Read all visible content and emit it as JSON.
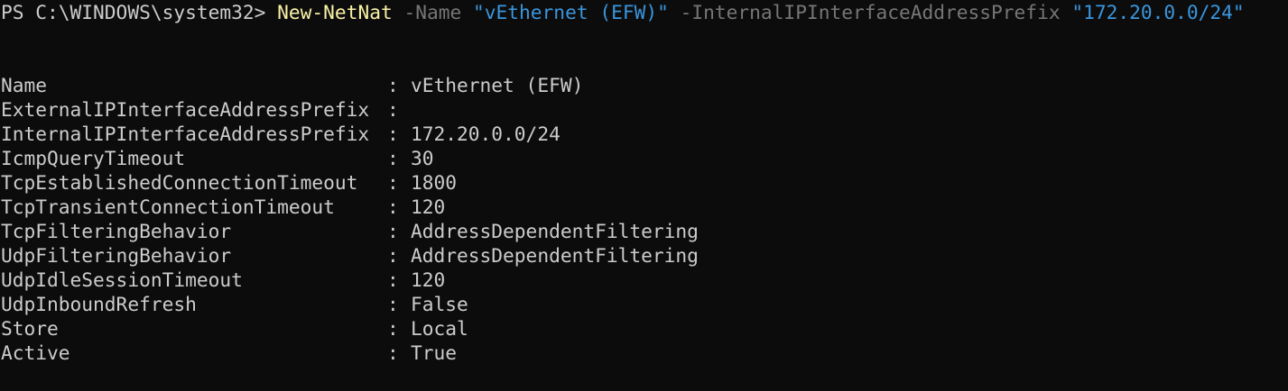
{
  "colors": {
    "background": "#0c0c0c",
    "foreground": "#cccccc",
    "cmdlet": "#f9f1a5",
    "parameter": "#767676",
    "string": "#3a96dd"
  },
  "command": {
    "prompt": "PS C:\\WINDOWS\\system32> ",
    "cmdlet": "New-NetNat",
    "param1": " -Name ",
    "value1": "\"vEthernet (EFW)\"",
    "param2": " -InternalIPInterfaceAddressPrefix ",
    "value2": "\"172.20.0.0/24\""
  },
  "output": {
    "separator": ":",
    "rows": [
      {
        "key": "Name",
        "value": "vEthernet (EFW)"
      },
      {
        "key": "ExternalIPInterfaceAddressPrefix",
        "value": ""
      },
      {
        "key": "InternalIPInterfaceAddressPrefix",
        "value": "172.20.0.0/24"
      },
      {
        "key": "IcmpQueryTimeout",
        "value": "30"
      },
      {
        "key": "TcpEstablishedConnectionTimeout",
        "value": "1800"
      },
      {
        "key": "TcpTransientConnectionTimeout",
        "value": "120"
      },
      {
        "key": "TcpFilteringBehavior",
        "value": "AddressDependentFiltering"
      },
      {
        "key": "UdpFilteringBehavior",
        "value": "AddressDependentFiltering"
      },
      {
        "key": "UdpIdleSessionTimeout",
        "value": "120"
      },
      {
        "key": "UdpInboundRefresh",
        "value": "False"
      },
      {
        "key": "Store",
        "value": "Local"
      },
      {
        "key": "Active",
        "value": "True"
      }
    ]
  }
}
